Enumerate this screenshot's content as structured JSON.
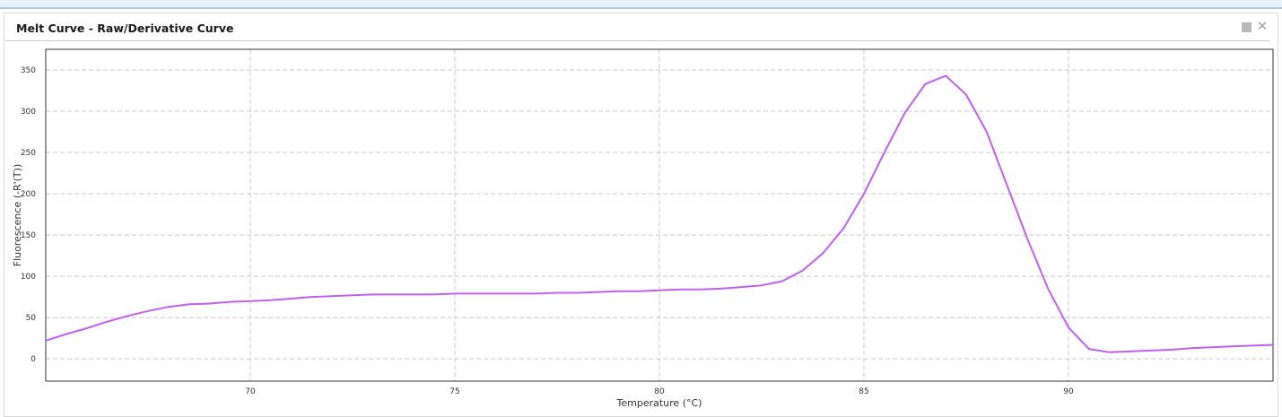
{
  "panel": {
    "title": "Melt Curve - Raw/Derivative Curve",
    "minimize_icon": "square-icon",
    "close_icon": "close-icon",
    "close_glyph": "✕"
  },
  "colors": {
    "curve": "#c060f0",
    "grid": "#c8c8c8",
    "plot_border": "#333333"
  },
  "chart_data": {
    "type": "line",
    "xlabel": "Temperature (°C)",
    "ylabel": "Fluorescence (-R'(T))",
    "xlim": [
      65.0,
      95.0
    ],
    "ylim": [
      -27,
      375
    ],
    "xticks": [
      70,
      75,
      80,
      85,
      90
    ],
    "yticks": [
      0,
      50,
      100,
      150,
      200,
      250,
      300,
      350
    ],
    "grid": true,
    "series": [
      {
        "x": [
          65.0,
          65.5,
          66.0,
          66.5,
          67.0,
          67.5,
          68.0,
          68.5,
          69.0,
          69.5,
          70.0,
          70.5,
          71.0,
          71.5,
          72.0,
          72.5,
          73.0,
          73.5,
          74.0,
          74.5,
          75.0,
          75.5,
          76.0,
          76.5,
          77.0,
          77.5,
          78.0,
          78.5,
          79.0,
          79.5,
          80.0,
          80.5,
          81.0,
          81.5,
          82.0,
          82.5,
          83.0,
          83.5,
          84.0,
          84.5,
          85.0,
          85.5,
          86.0,
          86.5,
          87.0,
          87.5,
          88.0,
          88.5,
          89.0,
          89.5,
          90.0,
          90.5,
          91.0,
          91.5,
          92.0,
          92.5,
          93.0,
          93.5,
          94.0,
          94.5,
          95.0
        ],
        "y": [
          22,
          30,
          37,
          45,
          52,
          58,
          63,
          66,
          67,
          69,
          70,
          71,
          73,
          75,
          76,
          77,
          78,
          78,
          78,
          78,
          79,
          79,
          79,
          79,
          79,
          80,
          80,
          81,
          82,
          82,
          83,
          84,
          84,
          85,
          87,
          89,
          94,
          107,
          128,
          158,
          200,
          250,
          298,
          333,
          343,
          320,
          275,
          210,
          145,
          85,
          38,
          12,
          8,
          9,
          10,
          11,
          13,
          14,
          15,
          16,
          17
        ]
      }
    ]
  }
}
